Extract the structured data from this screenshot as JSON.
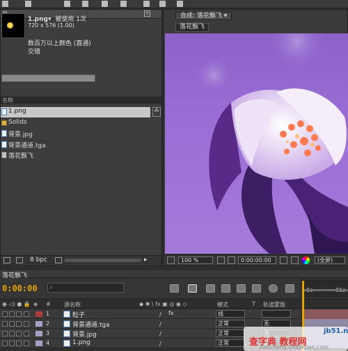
{
  "toolbar": {
    "tools": [
      "hand-tool",
      "zoom-tool",
      "rotate-tool",
      "camera-tool",
      "pan-tool",
      "mask-tool",
      "pen-tool",
      "text-tool",
      "brush-tool",
      "clone-tool",
      "eraser-tool",
      "puppet-tool"
    ]
  },
  "project": {
    "tab_label": "目",
    "file_name": "1.png▾",
    "usage": "被使用 1次",
    "dimensions": "720 x 576 (1.00)",
    "color_desc": "数百万以上颜色 (直通)",
    "interlace": "交错",
    "name_column": "名称",
    "items": [
      {
        "name": "1.png",
        "kind": "image",
        "selected": true
      },
      {
        "name": "Solids",
        "kind": "folder",
        "selected": false
      },
      {
        "name": "背景.jpg",
        "kind": "image",
        "selected": false
      },
      {
        "name": "背景通道.tga",
        "kind": "image",
        "selected": false
      },
      {
        "name": "落花飘飞",
        "kind": "composition",
        "selected": false
      }
    ],
    "bpc": "8 bpc"
  },
  "composition": {
    "tab_label": "合成: 落花飘飞 ▾",
    "sub_tab": "落花飘飞",
    "zoom": "100 %",
    "timecode": "0:00:00:00",
    "resolution": "(全屏)"
  },
  "timeline": {
    "tab_label": "落花飘飞",
    "timecode": "0:00:00",
    "ruler_labels": [
      "0s",
      "01s"
    ],
    "columns": {
      "name": "源名称",
      "switches": "◆ ✱ \\ fx ▣ ◎ ◉ ◇",
      "mode": "模式",
      "t": "T",
      "track": "轨道蒙版"
    },
    "layers": [
      {
        "num": "1",
        "name": "粒子",
        "mode": "线",
        "track": "",
        "label_color": "#b23b3b",
        "bar_color": "#8a5a5a",
        "fx": "fx"
      },
      {
        "num": "2",
        "name": "背景通道.tga",
        "mode": "正常",
        "track": "无",
        "label_color": "#a89fc4",
        "bar_color": "#8f89a6",
        "fx": ""
      },
      {
        "num": "3",
        "name": "背景.jpg",
        "mode": "正常",
        "track": "无",
        "label_color": "#a89fc4",
        "bar_color": "#8f89a6",
        "fx": ""
      },
      {
        "num": "4",
        "name": "1.png",
        "mode": "正常",
        "track": "无",
        "label_color": "#a89fc4",
        "bar_color": "#8f89a6",
        "fx": ""
      }
    ]
  },
  "watermark": {
    "site": "jb51.net",
    "title": "查字典 教程网",
    "url": "jiaocheng.chazidian.com"
  }
}
